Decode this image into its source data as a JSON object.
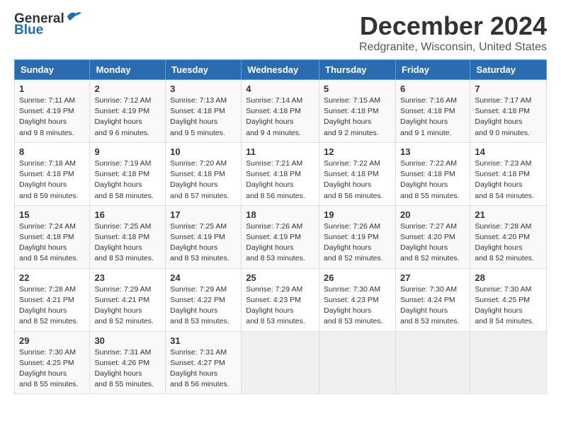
{
  "logo": {
    "line1": "General",
    "line2": "Blue"
  },
  "title": "December 2024",
  "subtitle": "Redgranite, Wisconsin, United States",
  "headers": [
    "Sunday",
    "Monday",
    "Tuesday",
    "Wednesday",
    "Thursday",
    "Friday",
    "Saturday"
  ],
  "weeks": [
    [
      {
        "day": "1",
        "sunrise": "7:11 AM",
        "sunset": "4:19 PM",
        "daylight": "9 hours and 8 minutes."
      },
      {
        "day": "2",
        "sunrise": "7:12 AM",
        "sunset": "4:19 PM",
        "daylight": "9 hours and 6 minutes."
      },
      {
        "day": "3",
        "sunrise": "7:13 AM",
        "sunset": "4:18 PM",
        "daylight": "9 hours and 5 minutes."
      },
      {
        "day": "4",
        "sunrise": "7:14 AM",
        "sunset": "4:18 PM",
        "daylight": "9 hours and 4 minutes."
      },
      {
        "day": "5",
        "sunrise": "7:15 AM",
        "sunset": "4:18 PM",
        "daylight": "9 hours and 2 minutes."
      },
      {
        "day": "6",
        "sunrise": "7:16 AM",
        "sunset": "4:18 PM",
        "daylight": "9 hours and 1 minute."
      },
      {
        "day": "7",
        "sunrise": "7:17 AM",
        "sunset": "4:18 PM",
        "daylight": "9 hours and 0 minutes."
      }
    ],
    [
      {
        "day": "8",
        "sunrise": "7:18 AM",
        "sunset": "4:18 PM",
        "daylight": "8 hours and 59 minutes."
      },
      {
        "day": "9",
        "sunrise": "7:19 AM",
        "sunset": "4:18 PM",
        "daylight": "8 hours and 58 minutes."
      },
      {
        "day": "10",
        "sunrise": "7:20 AM",
        "sunset": "4:18 PM",
        "daylight": "8 hours and 57 minutes."
      },
      {
        "day": "11",
        "sunrise": "7:21 AM",
        "sunset": "4:18 PM",
        "daylight": "8 hours and 56 minutes."
      },
      {
        "day": "12",
        "sunrise": "7:22 AM",
        "sunset": "4:18 PM",
        "daylight": "8 hours and 56 minutes."
      },
      {
        "day": "13",
        "sunrise": "7:22 AM",
        "sunset": "4:18 PM",
        "daylight": "8 hours and 55 minutes."
      },
      {
        "day": "14",
        "sunrise": "7:23 AM",
        "sunset": "4:18 PM",
        "daylight": "8 hours and 54 minutes."
      }
    ],
    [
      {
        "day": "15",
        "sunrise": "7:24 AM",
        "sunset": "4:18 PM",
        "daylight": "8 hours and 54 minutes."
      },
      {
        "day": "16",
        "sunrise": "7:25 AM",
        "sunset": "4:18 PM",
        "daylight": "8 hours and 53 minutes."
      },
      {
        "day": "17",
        "sunrise": "7:25 AM",
        "sunset": "4:19 PM",
        "daylight": "8 hours and 53 minutes."
      },
      {
        "day": "18",
        "sunrise": "7:26 AM",
        "sunset": "4:19 PM",
        "daylight": "8 hours and 53 minutes."
      },
      {
        "day": "19",
        "sunrise": "7:26 AM",
        "sunset": "4:19 PM",
        "daylight": "8 hours and 52 minutes."
      },
      {
        "day": "20",
        "sunrise": "7:27 AM",
        "sunset": "4:20 PM",
        "daylight": "8 hours and 52 minutes."
      },
      {
        "day": "21",
        "sunrise": "7:28 AM",
        "sunset": "4:20 PM",
        "daylight": "8 hours and 52 minutes."
      }
    ],
    [
      {
        "day": "22",
        "sunrise": "7:28 AM",
        "sunset": "4:21 PM",
        "daylight": "8 hours and 52 minutes."
      },
      {
        "day": "23",
        "sunrise": "7:29 AM",
        "sunset": "4:21 PM",
        "daylight": "8 hours and 52 minutes."
      },
      {
        "day": "24",
        "sunrise": "7:29 AM",
        "sunset": "4:22 PM",
        "daylight": "8 hours and 53 minutes."
      },
      {
        "day": "25",
        "sunrise": "7:29 AM",
        "sunset": "4:23 PM",
        "daylight": "8 hours and 53 minutes."
      },
      {
        "day": "26",
        "sunrise": "7:30 AM",
        "sunset": "4:23 PM",
        "daylight": "8 hours and 53 minutes."
      },
      {
        "day": "27",
        "sunrise": "7:30 AM",
        "sunset": "4:24 PM",
        "daylight": "8 hours and 53 minutes."
      },
      {
        "day": "28",
        "sunrise": "7:30 AM",
        "sunset": "4:25 PM",
        "daylight": "8 hours and 54 minutes."
      }
    ],
    [
      {
        "day": "29",
        "sunrise": "7:30 AM",
        "sunset": "4:25 PM",
        "daylight": "8 hours and 55 minutes."
      },
      {
        "day": "30",
        "sunrise": "7:31 AM",
        "sunset": "4:26 PM",
        "daylight": "8 hours and 55 minutes."
      },
      {
        "day": "31",
        "sunrise": "7:31 AM",
        "sunset": "4:27 PM",
        "daylight": "8 hours and 56 minutes."
      },
      null,
      null,
      null,
      null
    ]
  ]
}
